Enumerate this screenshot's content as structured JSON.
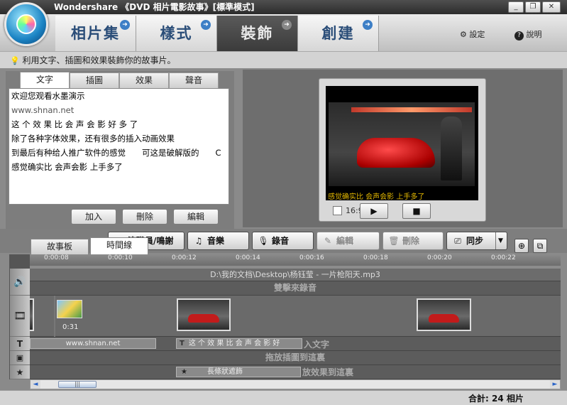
{
  "window": {
    "title": "Wondershare 《DVD 相片電影故事》[標準模式]",
    "min": "_",
    "max": "❐",
    "close": "✕"
  },
  "nav": {
    "tabs": [
      {
        "label": "相片集",
        "arrow": "➜"
      },
      {
        "label": "樣式",
        "arrow": "➜"
      },
      {
        "label": "裝飾",
        "arrow": "➜"
      },
      {
        "label": "創建",
        "arrow": "➜"
      }
    ],
    "active": 2,
    "settings": "設定",
    "help": "說明"
  },
  "hint": "利用文字、插圖和效果裝飾你的故事片。",
  "subtabs": [
    "文字",
    "插圖",
    "效果",
    "聲音"
  ],
  "text_items": [
    "欢迎您观看水墨演示",
    "www.shnan.net",
    "这 个 效 果 比 会 声 会 影 好 多 了",
    "除了各种字体效果，还有很多的插入动画效果",
    "到最后有种给人推广软件的感觉　　可这是破解版的　　C",
    "感觉确实比 会声会影 上手多了"
  ],
  "panel_buttons": {
    "add": "加入",
    "delete": "刪除",
    "edit": "編輯"
  },
  "preview": {
    "subtitle": "感觉确实比 会声会影 上手多了",
    "ratio": "16:9",
    "play": "▶",
    "stop": "■"
  },
  "tools": {
    "thanks": "演職員/鳴謝",
    "music": "音樂",
    "record": "錄音",
    "edit": "編輯",
    "delete": "刪除",
    "sync": "同步",
    "sync_arrow": "▼"
  },
  "timeline_tabs": [
    "故事板",
    "時間線"
  ],
  "zoom": {
    "in": "⊕",
    "fit": "⧉"
  },
  "ruler": [
    "0:00:08",
    "0:00:10",
    "0:00:12",
    "0:00:14",
    "0:00:16",
    "0:00:18",
    "0:00:20",
    "0:00:22"
  ],
  "tracks": {
    "audio_file": "D:\\我的文档\\Desktop\\杨钰莹 - 一片枪阳天.mp3",
    "record_hint": "雙擊來錄音",
    "clip_duration": "0:31",
    "text_item1": "www.shnan.net",
    "text_item2": "这 个 效 果 比 会 声 会 影 好",
    "text_hint": "入文字",
    "clipart_hint": "拖放插圖到這裏",
    "effect_name": "長條狀遮飾",
    "effect_hint": "放效果到這裏"
  },
  "icons": {
    "speaker": "🔊",
    "film": "🎞",
    "text": "T",
    "clipart": "▣",
    "star": "★",
    "gear": "⚙",
    "help": "?",
    "bulb": "💡"
  },
  "scroll": {
    "left": "◄",
    "right": "►",
    "grip": "|||"
  },
  "status": {
    "total": "合計: 24 相片"
  }
}
